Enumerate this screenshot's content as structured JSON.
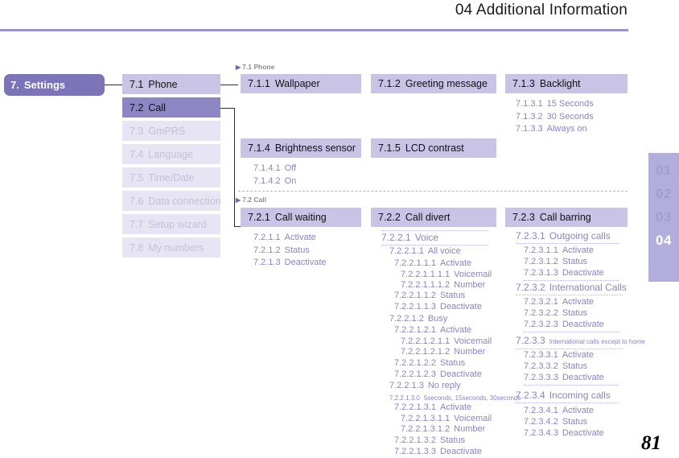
{
  "header": {
    "title": "04 Additional Information",
    "accent_color": "#9a93cb"
  },
  "page_tabs": {
    "items": [
      "01",
      "02",
      "03",
      "04"
    ],
    "active": "04",
    "strip_color": "#b2aedb",
    "inactive_color": "#a19ecd",
    "active_color": "#ffffff"
  },
  "page_number": "81",
  "root": {
    "num": "7.",
    "label": "Settings"
  },
  "sidebar": {
    "items": [
      {
        "num": "7.1",
        "label": "Phone",
        "state": "expanded"
      },
      {
        "num": "7.2",
        "label": "Call",
        "state": "active"
      },
      {
        "num": "7.3",
        "label": "GmPRS",
        "state": "dim"
      },
      {
        "num": "7.4",
        "label": "Language",
        "state": "dim"
      },
      {
        "num": "7.5",
        "label": "Time/Date",
        "state": "dim"
      },
      {
        "num": "7.6",
        "label": "Data connection",
        "state": "dim"
      },
      {
        "num": "7.7",
        "label": "Setup wizard",
        "state": "dim"
      },
      {
        "num": "7.8",
        "label": "My numbers",
        "state": "dim"
      }
    ]
  },
  "sections": [
    {
      "label_arrow": "▶",
      "label_num": "7.1",
      "label_text": "Phone",
      "boxes": [
        {
          "num": "7.1.1",
          "label": "Wallpaper"
        },
        {
          "num": "7.1.2",
          "label": "Greeting message"
        },
        {
          "num": "7.1.3",
          "label": "Backlight"
        },
        {
          "num": "7.1.4",
          "label": "Brightness sensor"
        },
        {
          "num": "7.1.5",
          "label": "LCD contrast"
        }
      ],
      "leaves": {
        "backlight": [
          {
            "num": "7.1.3.1",
            "label": "15 Seconds"
          },
          {
            "num": "7.1.3.2",
            "label": "30 Seconds"
          },
          {
            "num": "7.1.3.3",
            "label": "Always on"
          }
        ],
        "brightness": [
          {
            "num": "7.1.4.1",
            "label": "Off"
          },
          {
            "num": "7.1.4.2",
            "label": "On"
          }
        ]
      }
    },
    {
      "label_arrow": "▶",
      "label_num": "7.2",
      "label_text": "Call",
      "boxes": [
        {
          "num": "7.2.1",
          "label": "Call waiting"
        },
        {
          "num": "7.2.2",
          "label": "Call divert"
        },
        {
          "num": "7.2.3",
          "label": "Call barring"
        }
      ],
      "leaves": {
        "call_waiting": [
          {
            "num": "7.2.1.1",
            "label": "Activate"
          },
          {
            "num": "7.2.1.2",
            "label": "Status"
          },
          {
            "num": "7.2.1.3",
            "label": "Deactivate"
          }
        ],
        "call_divert": [
          {
            "num": "7.2.2.1",
            "label": "Voice"
          },
          {
            "num": "7.2.2.1.1",
            "label": "All voice"
          },
          {
            "num": "7.2.2.1.1.1",
            "label": "Activate"
          },
          {
            "num": "7.2.2.1.1.1.1",
            "label": "Voicemail"
          },
          {
            "num": "7.2.2.1.1.1.2",
            "label": "Number"
          },
          {
            "num": "7.2.2.1.1.2",
            "label": "Status"
          },
          {
            "num": "7.2.2.1.1.3",
            "label": "Deactivate"
          },
          {
            "num": "7.2.2.1.2",
            "label": "Busy"
          },
          {
            "num": "7.2.2.1.2.1",
            "label": "Activate"
          },
          {
            "num": "7.2.2.1.2.1.1",
            "label": "Voicemail"
          },
          {
            "num": "7.2.2.1.2.1.2",
            "label": "Number"
          },
          {
            "num": "7.2.2.1.2.2",
            "label": "Status"
          },
          {
            "num": "7.2.2.1.2.3",
            "label": "Deactivate"
          },
          {
            "num": "7.2.2.1.3",
            "label": "No reply"
          },
          {
            "num": "7.2.2.1.3.0",
            "label": "5seconds, 15seconds, 30seconds"
          },
          {
            "num": "7.2.2.1.3.1",
            "label": "Activate"
          },
          {
            "num": "7.2.2.1.3.1.1",
            "label": "Voicemail"
          },
          {
            "num": "7.2.2.1.3.1.2",
            "label": "Number"
          },
          {
            "num": "7.2.2.1.3.2",
            "label": "Status"
          },
          {
            "num": "7.2.2.1.3.3",
            "label": "Deactivate"
          }
        ],
        "call_barring": [
          {
            "num": "7.2.3.1",
            "label": "Outgoing calls"
          },
          {
            "num": "7.2.3.1.1",
            "label": "Activate"
          },
          {
            "num": "7.2.3.1.2",
            "label": "Status"
          },
          {
            "num": "7.2.3.1.3",
            "label": "Deactivate"
          },
          {
            "num": "7.2.3.2",
            "label": "International Calls"
          },
          {
            "num": "7.2.3.2.1",
            "label": "Activate"
          },
          {
            "num": "7.2.3.2.2",
            "label": "Status"
          },
          {
            "num": "7.2.3.2.3",
            "label": "Deactivate"
          },
          {
            "num": "7.2.3.3",
            "label": "International calls except to home"
          },
          {
            "num": "7.2.3.3.1",
            "label": "Activate"
          },
          {
            "num": "7.2.3.3.2",
            "label": "Status"
          },
          {
            "num": "7.2.3.3.3",
            "label": "Deactivate"
          },
          {
            "num": "7.2.3.4",
            "label": "Incoming calls"
          },
          {
            "num": "7.2.3.4.1",
            "label": "Activate"
          },
          {
            "num": "7.2.3.4.2",
            "label": "Status"
          },
          {
            "num": "7.2.3.4.3",
            "label": "Deactivate"
          }
        ]
      }
    }
  ]
}
